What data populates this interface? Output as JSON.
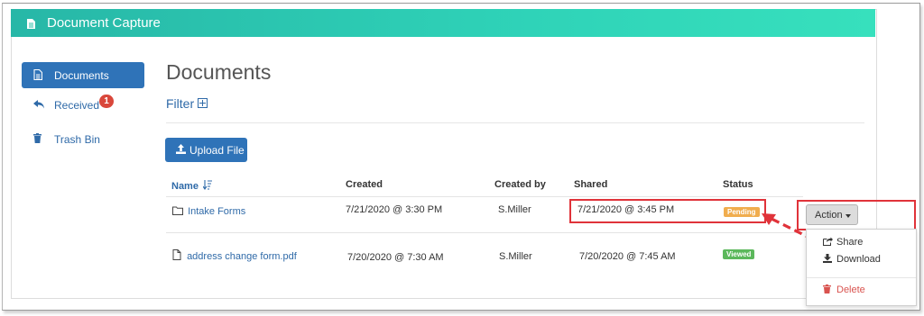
{
  "app": {
    "title": "Document Capture"
  },
  "sidebar": {
    "items": [
      {
        "label": "Documents",
        "icon": "document-icon",
        "active": true
      },
      {
        "label": "Received",
        "icon": "reply-icon",
        "badge": "1"
      },
      {
        "label": "Trash Bin",
        "icon": "trash-icon"
      }
    ]
  },
  "main": {
    "title": "Documents",
    "filter_label": "Filter",
    "upload_label": "Upload File",
    "table": {
      "columns": [
        "Name",
        "Created",
        "Created by",
        "Shared",
        "Status"
      ],
      "rows": [
        {
          "name": "Intake Forms",
          "icon": "folder-icon",
          "created": "7/21/2020 @ 3:30 PM",
          "created_by": "S.Miller",
          "shared": "7/21/2020 @ 3:45 PM",
          "status": "Pending",
          "status_color": "#f0ad4e"
        },
        {
          "name": "address change form.pdf",
          "icon": "file-icon",
          "created": "7/20/2020 @ 7:30 AM",
          "created_by": "S.Miller",
          "shared": "7/20/2020 @ 7:45 AM",
          "status": "Viewed",
          "status_color": "#5cb85c"
        }
      ]
    }
  },
  "action_menu": {
    "button_label": "Action",
    "items": [
      {
        "label": "Share",
        "icon": "share-icon"
      },
      {
        "label": "Download",
        "icon": "download-icon"
      },
      {
        "label": "Delete",
        "icon": "trash-icon",
        "color": "#d9534f"
      }
    ]
  },
  "colors": {
    "header_gradient_start": "#27b7a7",
    "header_gradient_end": "#37e0bd",
    "primary": "#2f73b8",
    "highlight_red": "#e0333a"
  }
}
